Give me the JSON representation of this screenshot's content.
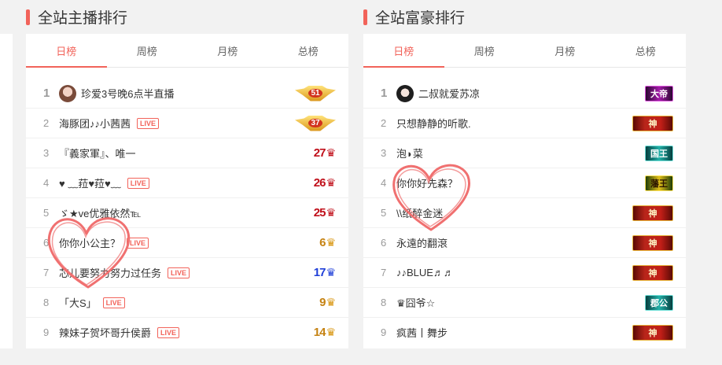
{
  "anchor": {
    "title": "全站主播排行",
    "tabs": [
      "日榜",
      "周榜",
      "月榜",
      "总榜"
    ],
    "active_tab": 0,
    "rows": [
      {
        "rank": "1",
        "name": "珍爱3号晚6点半直播",
        "avatar": true,
        "live": false,
        "badge": {
          "type": "wing",
          "level": "51"
        }
      },
      {
        "rank": "2",
        "name": "海豚团♪♪小茜茜",
        "avatar": false,
        "live": true,
        "badge": {
          "type": "wing",
          "level": "37"
        }
      },
      {
        "rank": "3",
        "name": "『義家軍』、唯一",
        "avatar": false,
        "live": false,
        "badge": {
          "type": "level",
          "level": "27",
          "color": "red"
        }
      },
      {
        "rank": "4",
        "name": "♥ ﹏菈♥菈♥﹏",
        "avatar": false,
        "live": true,
        "badge": {
          "type": "level",
          "level": "26",
          "color": "red"
        }
      },
      {
        "rank": "5",
        "name": "ゞ★ve优雅依然℡",
        "avatar": false,
        "live": false,
        "badge": {
          "type": "level",
          "level": "25",
          "color": "red"
        }
      },
      {
        "rank": "6",
        "name": "你你小公主？",
        "avatar": false,
        "live": true,
        "badge": {
          "type": "level",
          "level": "6",
          "color": "gold"
        }
      },
      {
        "rank": "7",
        "name": "芯儿要努力努力过任务",
        "avatar": false,
        "live": true,
        "badge": {
          "type": "level",
          "level": "17",
          "color": "blue"
        }
      },
      {
        "rank": "8",
        "name": "「大S」",
        "avatar": false,
        "live": true,
        "badge": {
          "type": "level",
          "level": "9",
          "color": "gold"
        }
      },
      {
        "rank": "9",
        "name": "辣妹子贺坏哥升侯爵",
        "avatar": false,
        "live": true,
        "badge": {
          "type": "level",
          "level": "14",
          "color": "gold"
        }
      }
    ]
  },
  "rich": {
    "title": "全站富豪排行",
    "tabs": [
      "日榜",
      "周榜",
      "月榜",
      "总榜"
    ],
    "active_tab": 0,
    "rows": [
      {
        "rank": "1",
        "name": "二叔就爱苏凉",
        "avatar": true,
        "badge": {
          "text": "大帝",
          "style": "purple"
        }
      },
      {
        "rank": "2",
        "name": "只想静静的听歌.",
        "avatar": false,
        "badge": {
          "text": "神",
          "style": "god"
        }
      },
      {
        "rank": "3",
        "name": "泡◗菜",
        "avatar": false,
        "badge": {
          "text": "国王",
          "style": "teal"
        }
      },
      {
        "rank": "4",
        "name": "你你好先森？",
        "avatar": false,
        "badge": {
          "text": "藩王",
          "style": "king"
        }
      },
      {
        "rank": "5",
        "name": "\\\\纸醉金迷",
        "avatar": false,
        "badge": {
          "text": "神",
          "style": "god"
        }
      },
      {
        "rank": "6",
        "name": "永遠的翻滾",
        "avatar": false,
        "badge": {
          "text": "神",
          "style": "god"
        }
      },
      {
        "rank": "7",
        "name": "♪♪BLUE♬♬",
        "avatar": false,
        "badge": {
          "text": "神",
          "style": "god"
        }
      },
      {
        "rank": "8",
        "name": "♛囧爷☆",
        "avatar": false,
        "badge": {
          "text": "郡公",
          "style": "teal"
        }
      },
      {
        "rank": "9",
        "name": "疯茜丨舞步",
        "avatar": false,
        "badge": {
          "text": "神",
          "style": "god"
        }
      }
    ]
  },
  "live_label": "LIVE",
  "icons": {
    "crown": "crown-icon",
    "heart": "heart-doodle-icon"
  },
  "colors": {
    "accent": "#f2635a",
    "level_red": "#c00f1a",
    "level_gold": "#c58212",
    "level_blue": "#1f3fd8"
  }
}
